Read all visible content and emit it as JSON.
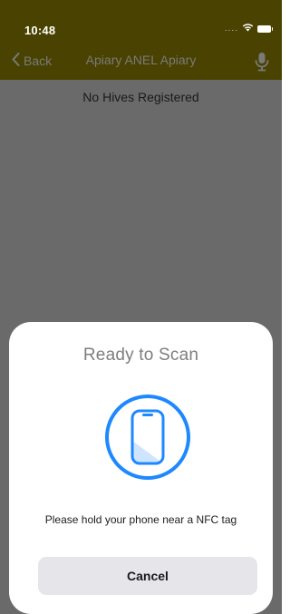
{
  "status_bar": {
    "time": "10:48",
    "signal": "....",
    "icons": [
      "wifi-icon",
      "battery-icon"
    ]
  },
  "nav": {
    "back_label": "Back",
    "title": "Apiary ANEL Apiary",
    "mic_icon": "microphone-icon"
  },
  "content": {
    "empty_message": "No Hives Registered"
  },
  "nfc_sheet": {
    "title": "Ready to Scan",
    "icon": "nfc-phone-icon",
    "instruction": "Please hold your phone near a NFC tag",
    "cancel_label": "Cancel"
  },
  "colors": {
    "bar_background": "#4a4200",
    "dimmed_background": "#6a6a6a",
    "scan_blue": "#1e88ff",
    "button_gray": "#e5e5ea"
  }
}
